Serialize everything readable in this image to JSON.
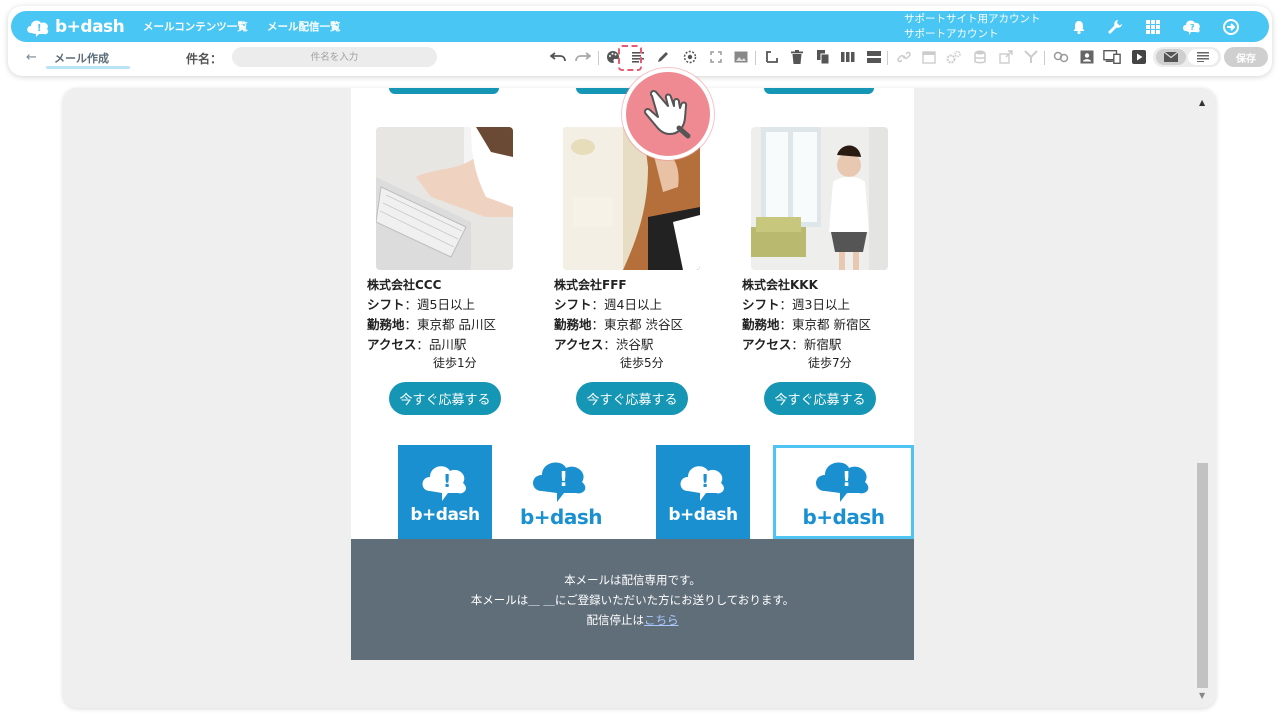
{
  "header": {
    "logo_text": "b+dash",
    "nav": [
      "メールコンテンツ一覧",
      "メール配信一覧"
    ],
    "account_line1": "サポートサイト用アカウント",
    "account_line2": "サポートアカウント",
    "icons": [
      "bell-icon",
      "wrench-icon",
      "grid-icon",
      "help-bubble-icon",
      "logout-icon"
    ]
  },
  "toolbar": {
    "back_icon": "←",
    "title": "メール作成",
    "subject_label": "件名：",
    "subject_placeholder": "件名を入力",
    "save_label": "保存",
    "icons": [
      "undo-icon",
      "redo-icon",
      "palette-icon",
      "text-align-icon",
      "pen-icon",
      "target-icon",
      "fullscreen-icon",
      "image-icon",
      "crop-icon",
      "trash-icon",
      "copy-icon",
      "columns-icon",
      "rows-icon",
      "link-icon",
      "calendar-icon",
      "settings-icon",
      "database-icon",
      "export-icon",
      "filter-icon",
      "merge-icon",
      "contact-card-icon",
      "device-preview-icon",
      "play-icon"
    ],
    "modes": [
      "mail-icon",
      "text-lines-icon"
    ]
  },
  "mail": {
    "cards": [
      {
        "company": "株式会社CCC",
        "shift_label": "シフト",
        "shift": "：週5日以上",
        "location_label": "勤務地",
        "location": "：東京都 品川区",
        "access_label": "アクセス",
        "access": "：品川駅",
        "walk": "徒歩1分",
        "apply": "今すぐ応募する"
      },
      {
        "company": "株式会社FFF",
        "shift_label": "シフト",
        "shift": "：週4日以上",
        "location_label": "勤務地",
        "location": "：東京都 渋谷区",
        "access_label": "アクセス",
        "access": "：渋谷駅",
        "walk": "徒歩5分",
        "apply": "今すぐ応募する"
      },
      {
        "company": "株式会社KKK",
        "shift_label": "シフト",
        "shift": "：週3日以上",
        "location_label": "勤務地",
        "location": "：東京都 新宿区",
        "access_label": "アクセス",
        "access": "：新宿駅",
        "walk": "徒歩7分",
        "apply": "今すぐ応募する"
      }
    ],
    "banner_text": "b+dash",
    "footer": {
      "line1": "本メールは配信専用です。",
      "line2": "本メールは＿ ＿にご登録いただいた方にお送りしております。",
      "line3_prefix": "配信停止は",
      "line3_link": "こちら"
    }
  },
  "colors": {
    "brand": "#49c6f3",
    "button": "#1596b4",
    "footer": "#606e79",
    "banner_blue": "#1a90d0",
    "pointer": "#f08a92"
  }
}
